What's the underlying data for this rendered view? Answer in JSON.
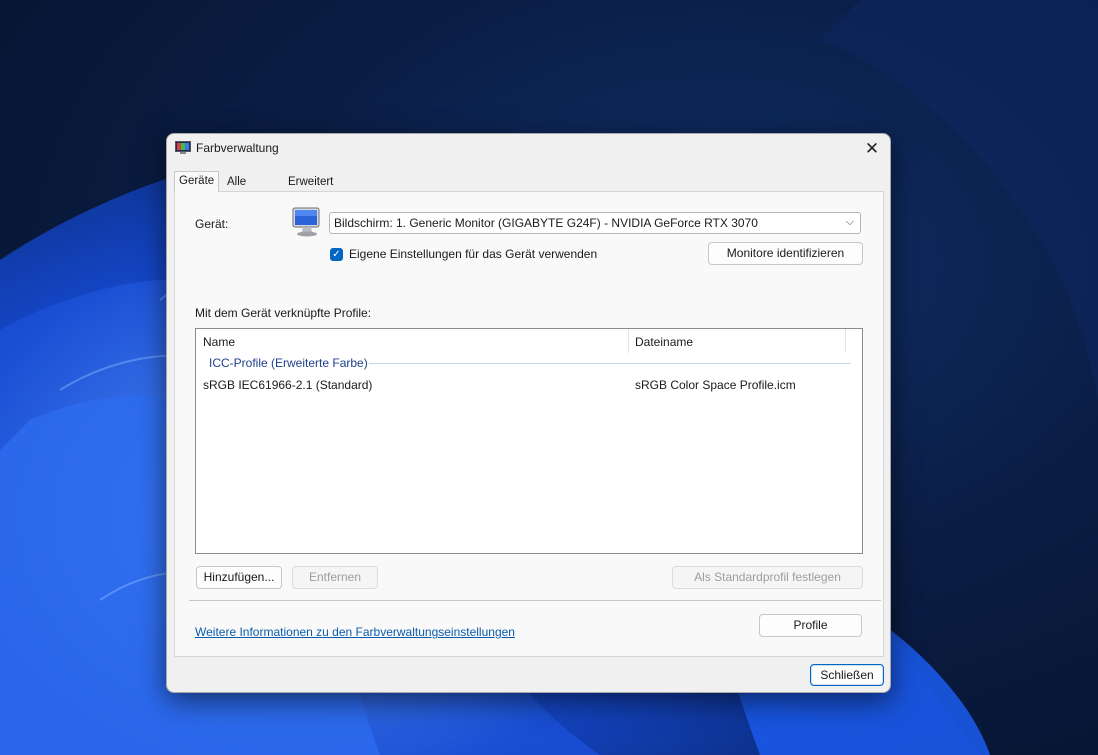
{
  "window": {
    "title": "Farbverwaltung",
    "close_glyph": "✕"
  },
  "tabs": [
    {
      "label": "Geräte",
      "active": true
    },
    {
      "label": "Alle Profile",
      "active": false
    },
    {
      "label": "Erweitert",
      "active": false
    }
  ],
  "device": {
    "label": "Gerät:",
    "selected": "Bildschirm: 1. Generic Monitor (GIGABYTE G24F) - NVIDIA GeForce RTX 3070",
    "dropdown_arrow": "⌵",
    "use_own_settings_label": "Eigene Einstellungen für das Gerät verwenden",
    "use_own_settings_checked": true,
    "identify_button": "Monitore identifizieren"
  },
  "profiles": {
    "section_label": "Mit dem Gerät verknüpfte Profile:",
    "columns": [
      "Name",
      "Dateiname"
    ],
    "group": "ICC-Profile (Erweiterte Farbe)",
    "rows": [
      {
        "name": "sRGB IEC61966-2.1 (Standard)",
        "file": "sRGB Color Space Profile.icm"
      }
    ],
    "add_button": "Hinzufügen...",
    "remove_button": "Entfernen",
    "set_default_button": "Als Standardprofil festlegen"
  },
  "footer": {
    "more_info_link": "Weitere Informationen zu den Farbverwaltungseinstellungen",
    "profiles_button": "Profile",
    "close_button": "Schließen"
  },
  "colors": {
    "accent": "#0067c0",
    "link": "#0b5cad",
    "group_header": "#1e3f8a"
  }
}
